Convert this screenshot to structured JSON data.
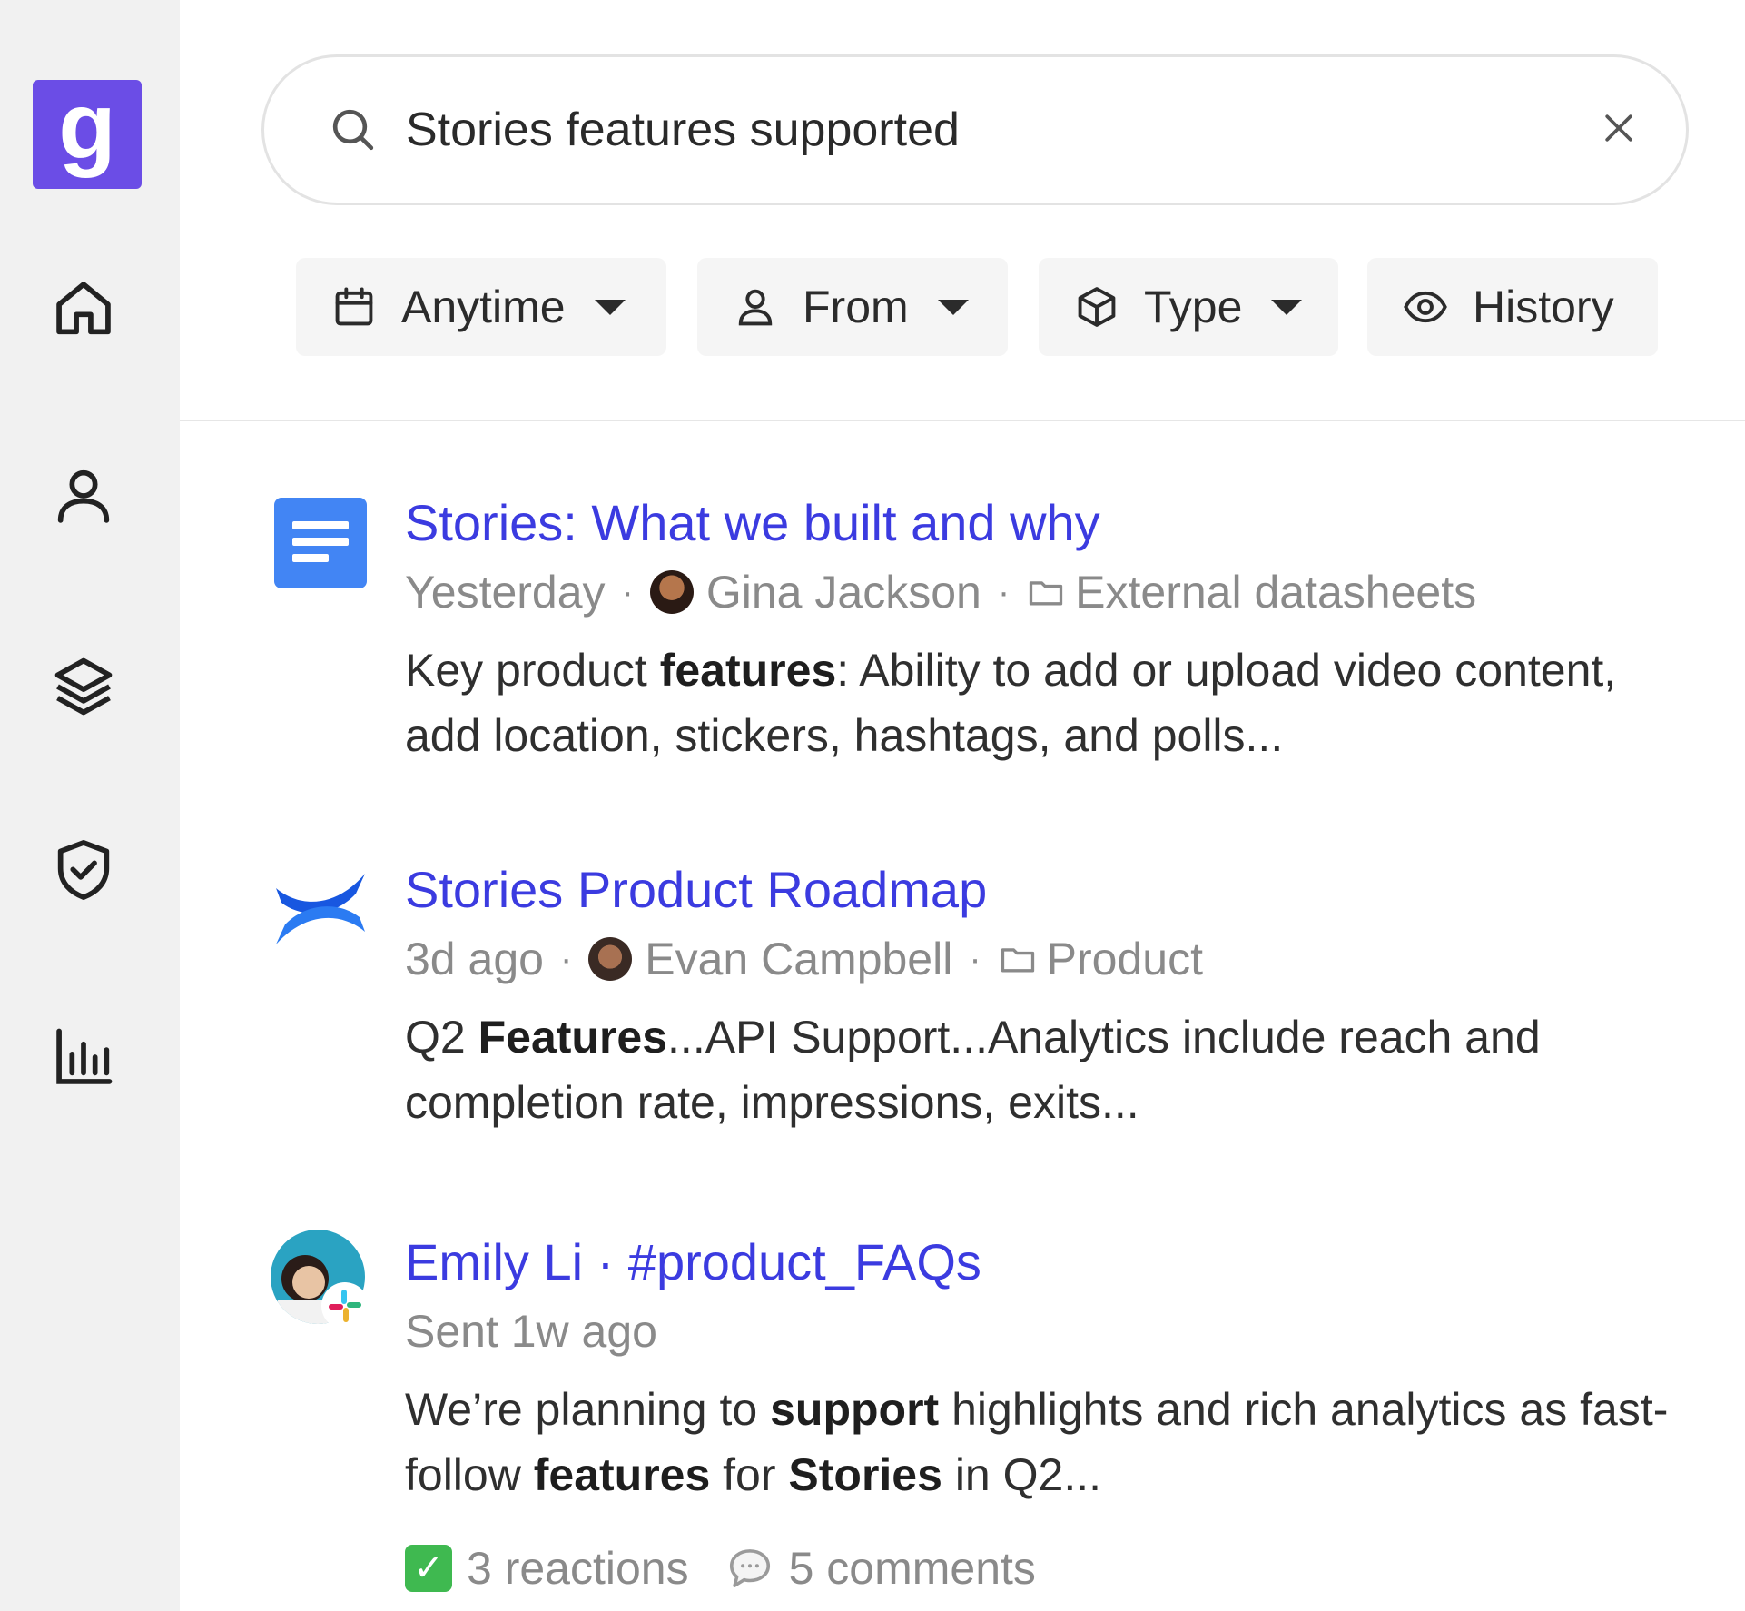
{
  "app": {
    "logo_letter": "g",
    "accent_color": "#6b4de6"
  },
  "sidebar": {
    "items": [
      {
        "icon": "home-icon"
      },
      {
        "icon": "person-icon"
      },
      {
        "icon": "layers-icon"
      },
      {
        "icon": "shield-check-icon"
      },
      {
        "icon": "bar-chart-icon"
      }
    ]
  },
  "search": {
    "query": "Stories features supported"
  },
  "filters": {
    "anytime": "Anytime",
    "from": "From",
    "type": "Type",
    "history": "History"
  },
  "results": [
    {
      "title": "Stories: What we built and why",
      "time": "Yesterday",
      "author": "Gina Jackson",
      "folder": "External datasheets",
      "snippet_parts": [
        "Key product ",
        "features",
        ": Ability to add or upload video content, add location, stickers, hashtags, and polls..."
      ],
      "source_icon": "google-docs-icon"
    },
    {
      "title": "Stories Product Roadmap",
      "time": "3d ago",
      "author": "Evan Campbell",
      "folder": "Product",
      "snippet_parts": [
        "Q2 ",
        "Features",
        "...API Support...Analytics include reach and completion rate, impressions, exits..."
      ],
      "source_icon": "confluence-icon"
    },
    {
      "title": "Emily Li · #product_FAQs",
      "time": "Sent 1w ago",
      "snippet_parts": [
        "We’re planning to ",
        "support",
        " highlights and rich analytics as fast-follow ",
        "features",
        " for ",
        "Stories",
        " in Q2..."
      ],
      "reactions": "3 reactions",
      "comments": "5 comments",
      "source_icon": "slack-icon"
    }
  ]
}
